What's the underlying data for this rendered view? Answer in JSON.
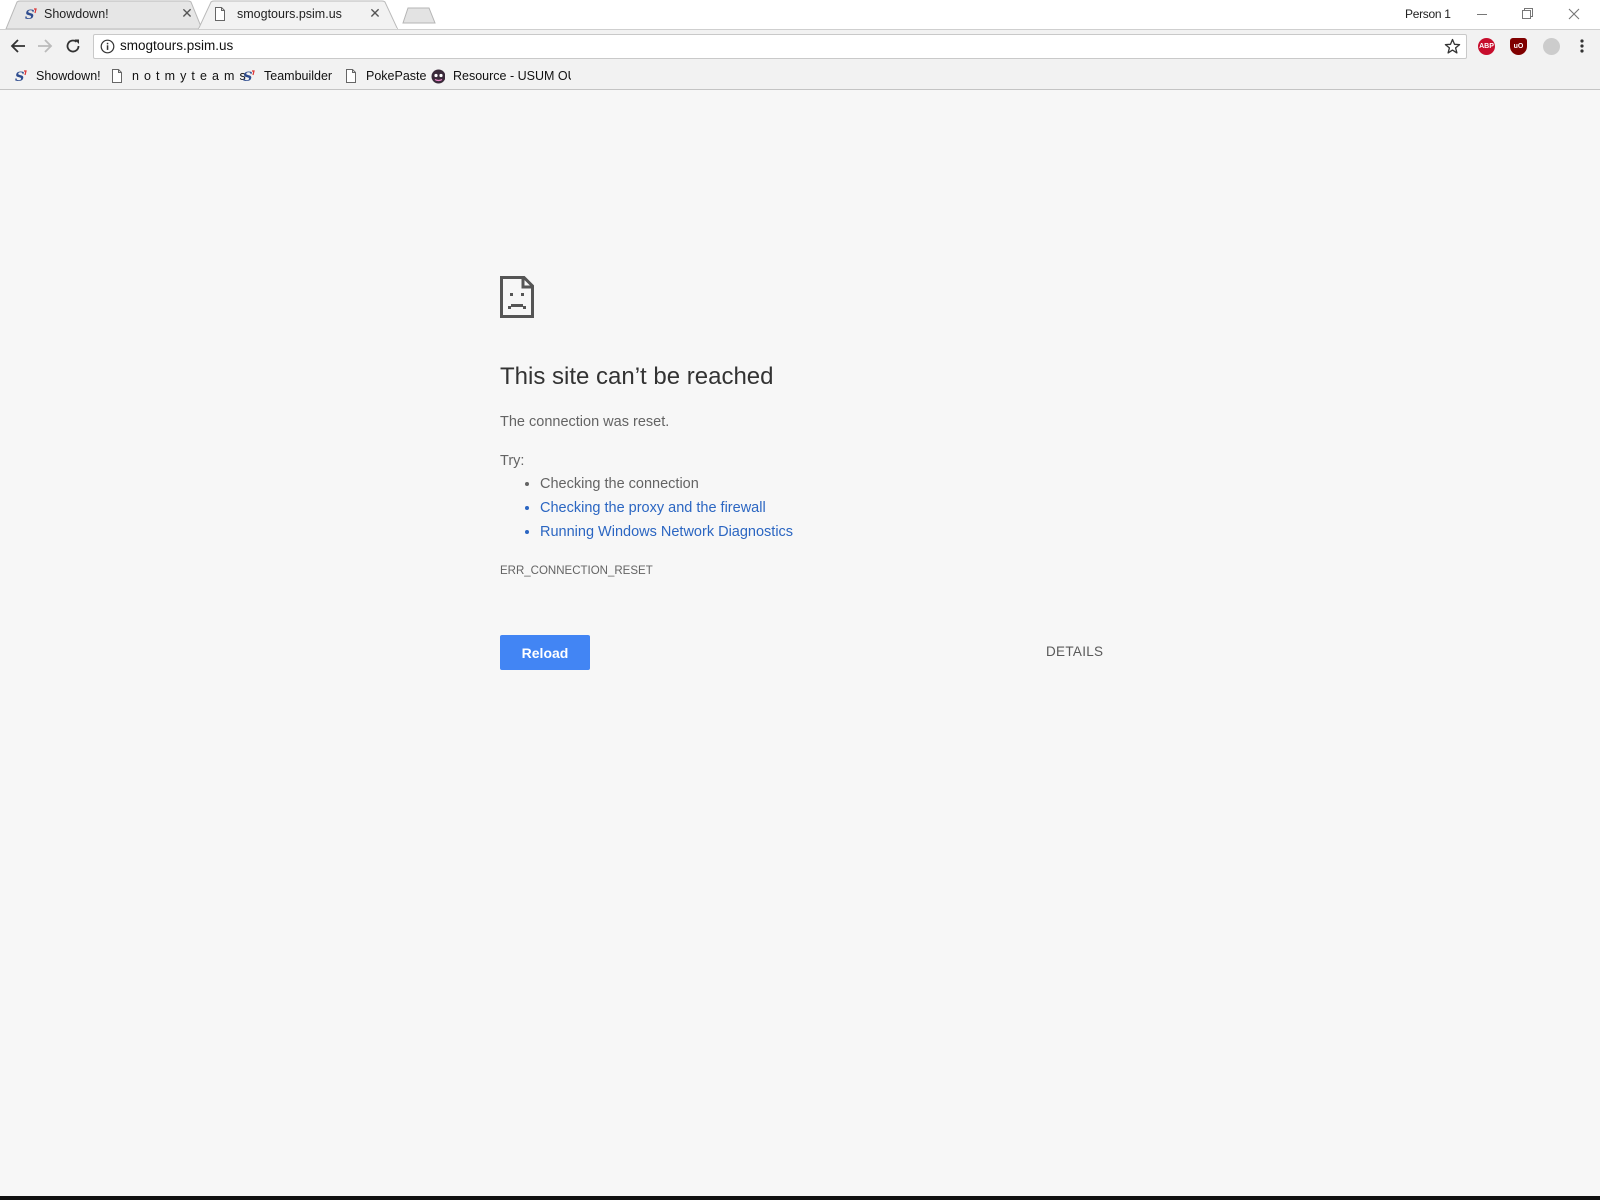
{
  "tabs": [
    {
      "title": "Showdown!",
      "icon": "showdown-s-icon",
      "active": false
    },
    {
      "title": "smogtours.psim.us",
      "icon": "page-icon",
      "active": true
    }
  ],
  "window": {
    "profile": "Person 1"
  },
  "toolbar": {
    "url": "smogtours.psim.us",
    "extensions": [
      {
        "name": "adblock-plus",
        "label": "ABP",
        "color": "#c70d2c"
      },
      {
        "name": "ublock-origin",
        "label": "uO",
        "color": "#800000"
      },
      {
        "name": "extension-grey",
        "label": "",
        "color": "#cccccc"
      }
    ]
  },
  "bookmarks": [
    {
      "label": "Showdown!",
      "icon": "showdown-s-icon"
    },
    {
      "label": "n o t m y t e a m s",
      "icon": "page-icon"
    },
    {
      "label": "Teambuilder",
      "icon": "showdown-s-icon"
    },
    {
      "label": "PokePaste",
      "icon": "page-icon"
    },
    {
      "label": "Resource - USUM OU",
      "icon": "smogon-icon"
    }
  ],
  "error": {
    "heading": "This site can’t be reached",
    "description": "The connection was reset.",
    "try_label": "Try:",
    "suggestions": [
      {
        "text": "Checking the connection",
        "link": false
      },
      {
        "text": "Checking the proxy and the firewall",
        "link": true
      },
      {
        "text": "Running Windows Network Diagnostics",
        "link": true
      }
    ],
    "code": "ERR_CONNECTION_RESET",
    "reload_label": "Reload",
    "details_label": "DETAILS"
  },
  "colors": {
    "accent": "#4285f4",
    "link": "#2b66c2",
    "page_bg": "#f7f7f7"
  }
}
